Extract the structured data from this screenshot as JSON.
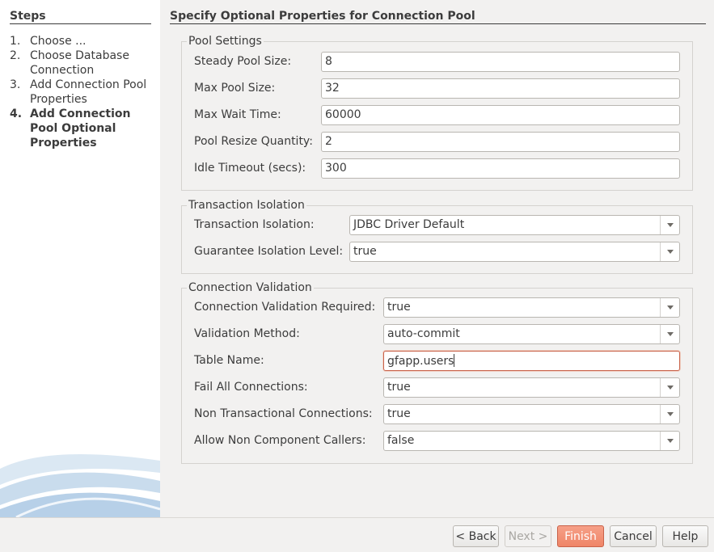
{
  "steps": {
    "title": "Steps",
    "items": [
      {
        "num": "1.",
        "label": "Choose ..."
      },
      {
        "num": "2.",
        "label": "Choose Database Connection"
      },
      {
        "num": "3.",
        "label": "Add Connection Pool Properties"
      },
      {
        "num": "4.",
        "label": "Add Connection Pool Optional Properties"
      }
    ]
  },
  "page": {
    "title": "Specify Optional Properties for Connection Pool"
  },
  "pool_settings": {
    "title": "Pool Settings",
    "steady_label": "Steady Pool Size:",
    "steady_value": "8",
    "max_label": "Max Pool Size:",
    "max_value": "32",
    "wait_label": "Max Wait Time:",
    "wait_value": "60000",
    "resize_label": "Pool Resize Quantity:",
    "resize_value": "2",
    "idle_label": "Idle Timeout (secs):",
    "idle_value": "300"
  },
  "transaction": {
    "title": "Transaction Isolation",
    "isolation_label": "Transaction Isolation:",
    "isolation_value": "JDBC Driver Default",
    "guarantee_label": "Guarantee Isolation Level:",
    "guarantee_value": "true"
  },
  "validation": {
    "title": "Connection Validation",
    "required_label": "Connection Validation Required:",
    "required_value": "true",
    "method_label": "Validation Method:",
    "method_value": "auto-commit",
    "table_label": "Table Name:",
    "table_value": "gfapp.users",
    "failall_label": "Fail All Connections:",
    "failall_value": "true",
    "nontx_label": "Non Transactional Connections:",
    "nontx_value": "true",
    "noncomp_label": "Allow Non Component Callers:",
    "noncomp_value": "false"
  },
  "buttons": {
    "back": "< Back",
    "next": "Next >",
    "finish": "Finish",
    "cancel": "Cancel",
    "help": "Help"
  }
}
